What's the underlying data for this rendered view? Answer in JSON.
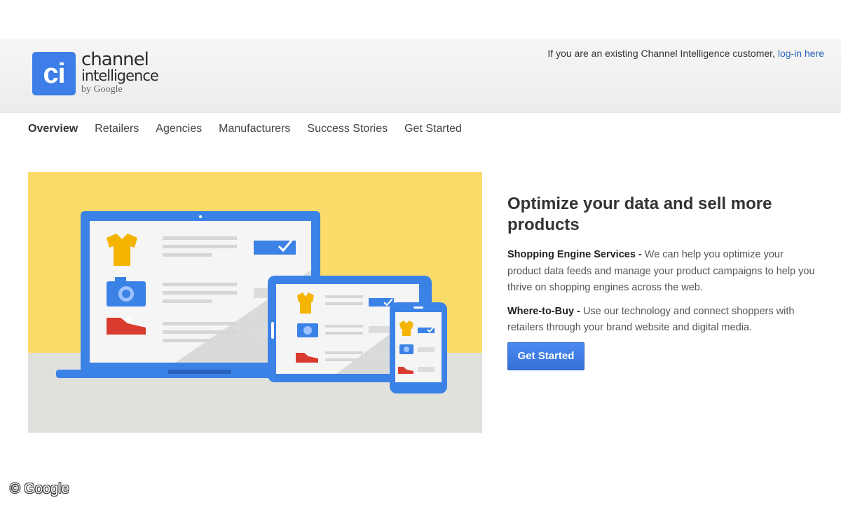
{
  "brand": {
    "badge": "ci",
    "line1": "channel",
    "line2": "intelligence",
    "line3": "by Google",
    "color": "#3d7ee8"
  },
  "header": {
    "customer_text": "If you are an existing Channel Intelligence customer, ",
    "login_link": "log-in here"
  },
  "nav": {
    "items": [
      {
        "label": "Overview"
      },
      {
        "label": "Retailers"
      },
      {
        "label": "Agencies"
      },
      {
        "label": "Manufacturers"
      },
      {
        "label": "Success Stories"
      },
      {
        "label": "Get Started"
      }
    ],
    "active": "Overview"
  },
  "hero": {
    "illustration": "laptop-tablet-phone-product-listing",
    "colors": {
      "yellow": "#fbdc6a",
      "blue": "#3b82e6",
      "floor": "#e0e0dc"
    },
    "product_icons": [
      "shirt-icon",
      "camera-icon",
      "shoe-icon",
      "checkmark-icon"
    ]
  },
  "main": {
    "headline": "Optimize your data and sell more products",
    "sections": [
      {
        "title": "Shopping Engine Services -",
        "body": " We can help you optimize your product data feeds and manage your product campaigns to help you thrive on shopping engines across the web."
      },
      {
        "title": "Where-to-Buy -",
        "body": " Use our technology and connect shoppers with retailers through your brand website and digital media."
      }
    ],
    "cta_label": "Get Started",
    "cta_color": "#3a78e0"
  },
  "watermark": "© Google"
}
